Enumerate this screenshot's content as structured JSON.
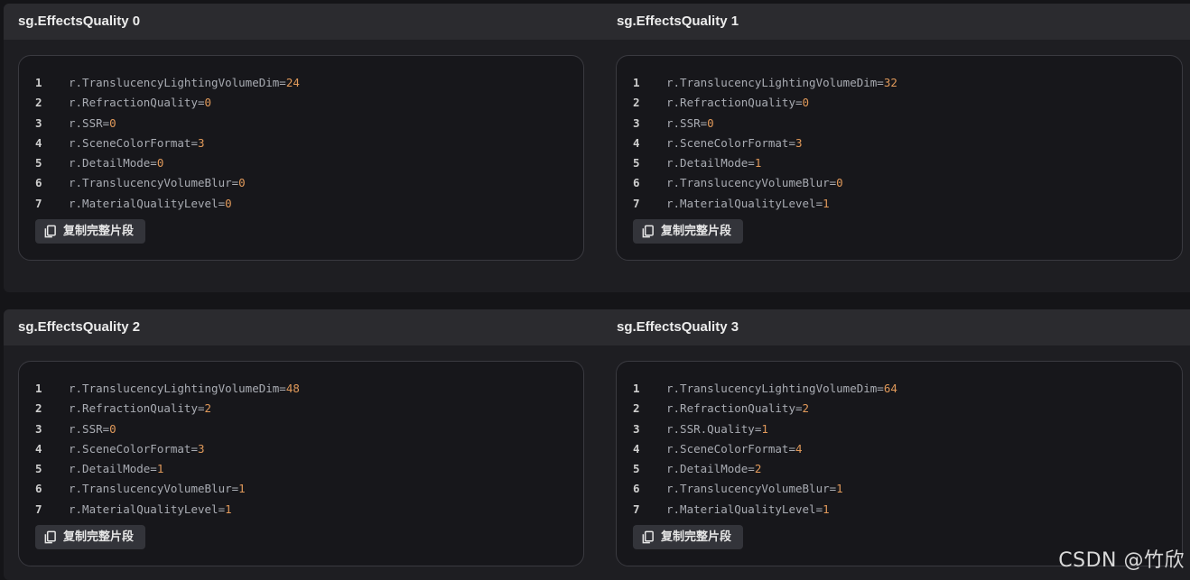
{
  "tables": [
    {
      "headers": [
        "sg.EffectsQuality 0",
        "sg.EffectsQuality 1"
      ],
      "cells": [
        {
          "lines": [
            {
              "num": "1",
              "key": "r.TranslucencyLightingVolumeDim=",
              "val": "24"
            },
            {
              "num": "2",
              "key": "r.RefractionQuality=",
              "val": "0"
            },
            {
              "num": "3",
              "key": "r.SSR=",
              "val": "0"
            },
            {
              "num": "4",
              "key": "r.SceneColorFormat=",
              "val": "3"
            },
            {
              "num": "5",
              "key": "r.DetailMode=",
              "val": "0"
            },
            {
              "num": "6",
              "key": "r.TranslucencyVolumeBlur=",
              "val": "0"
            },
            {
              "num": "7",
              "key": "r.MaterialQualityLevel=",
              "val": "0"
            }
          ],
          "copy_label": "复制完整片段"
        },
        {
          "lines": [
            {
              "num": "1",
              "key": "r.TranslucencyLightingVolumeDim=",
              "val": "32"
            },
            {
              "num": "2",
              "key": "r.RefractionQuality=",
              "val": "0"
            },
            {
              "num": "3",
              "key": "r.SSR=",
              "val": "0"
            },
            {
              "num": "4",
              "key": "r.SceneColorFormat=",
              "val": "3"
            },
            {
              "num": "5",
              "key": "r.DetailMode=",
              "val": "1"
            },
            {
              "num": "6",
              "key": "r.TranslucencyVolumeBlur=",
              "val": "0"
            },
            {
              "num": "7",
              "key": "r.MaterialQualityLevel=",
              "val": "1"
            }
          ],
          "copy_label": "复制完整片段"
        }
      ]
    },
    {
      "headers": [
        "sg.EffectsQuality 2",
        "sg.EffectsQuality 3"
      ],
      "cells": [
        {
          "lines": [
            {
              "num": "1",
              "key": "r.TranslucencyLightingVolumeDim=",
              "val": "48"
            },
            {
              "num": "2",
              "key": "r.RefractionQuality=",
              "val": "2"
            },
            {
              "num": "3",
              "key": "r.SSR=",
              "val": "0"
            },
            {
              "num": "4",
              "key": "r.SceneColorFormat=",
              "val": "3"
            },
            {
              "num": "5",
              "key": "r.DetailMode=",
              "val": "1"
            },
            {
              "num": "6",
              "key": "r.TranslucencyVolumeBlur=",
              "val": "1"
            },
            {
              "num": "7",
              "key": "r.MaterialQualityLevel=",
              "val": "1"
            }
          ],
          "copy_label": "复制完整片段"
        },
        {
          "lines": [
            {
              "num": "1",
              "key": "r.TranslucencyLightingVolumeDim=",
              "val": "64"
            },
            {
              "num": "2",
              "key": "r.RefractionQuality=",
              "val": "2"
            },
            {
              "num": "3",
              "key": "r.SSR.Quality=",
              "val": "1"
            },
            {
              "num": "4",
              "key": "r.SceneColorFormat=",
              "val": "4"
            },
            {
              "num": "5",
              "key": "r.DetailMode=",
              "val": "2"
            },
            {
              "num": "6",
              "key": "r.TranslucencyVolumeBlur=",
              "val": "1"
            },
            {
              "num": "7",
              "key": "r.MaterialQualityLevel=",
              "val": "1"
            }
          ],
          "copy_label": "复制完整片段"
        }
      ]
    }
  ],
  "watermark": "CSDN @竹欣",
  "icons": {
    "copy": "copy-icon"
  },
  "colors": {
    "value": "#e0995a",
    "key": "#a9acb3",
    "header_bg": "#2b2b2f",
    "card_border": "#3a3a40"
  }
}
